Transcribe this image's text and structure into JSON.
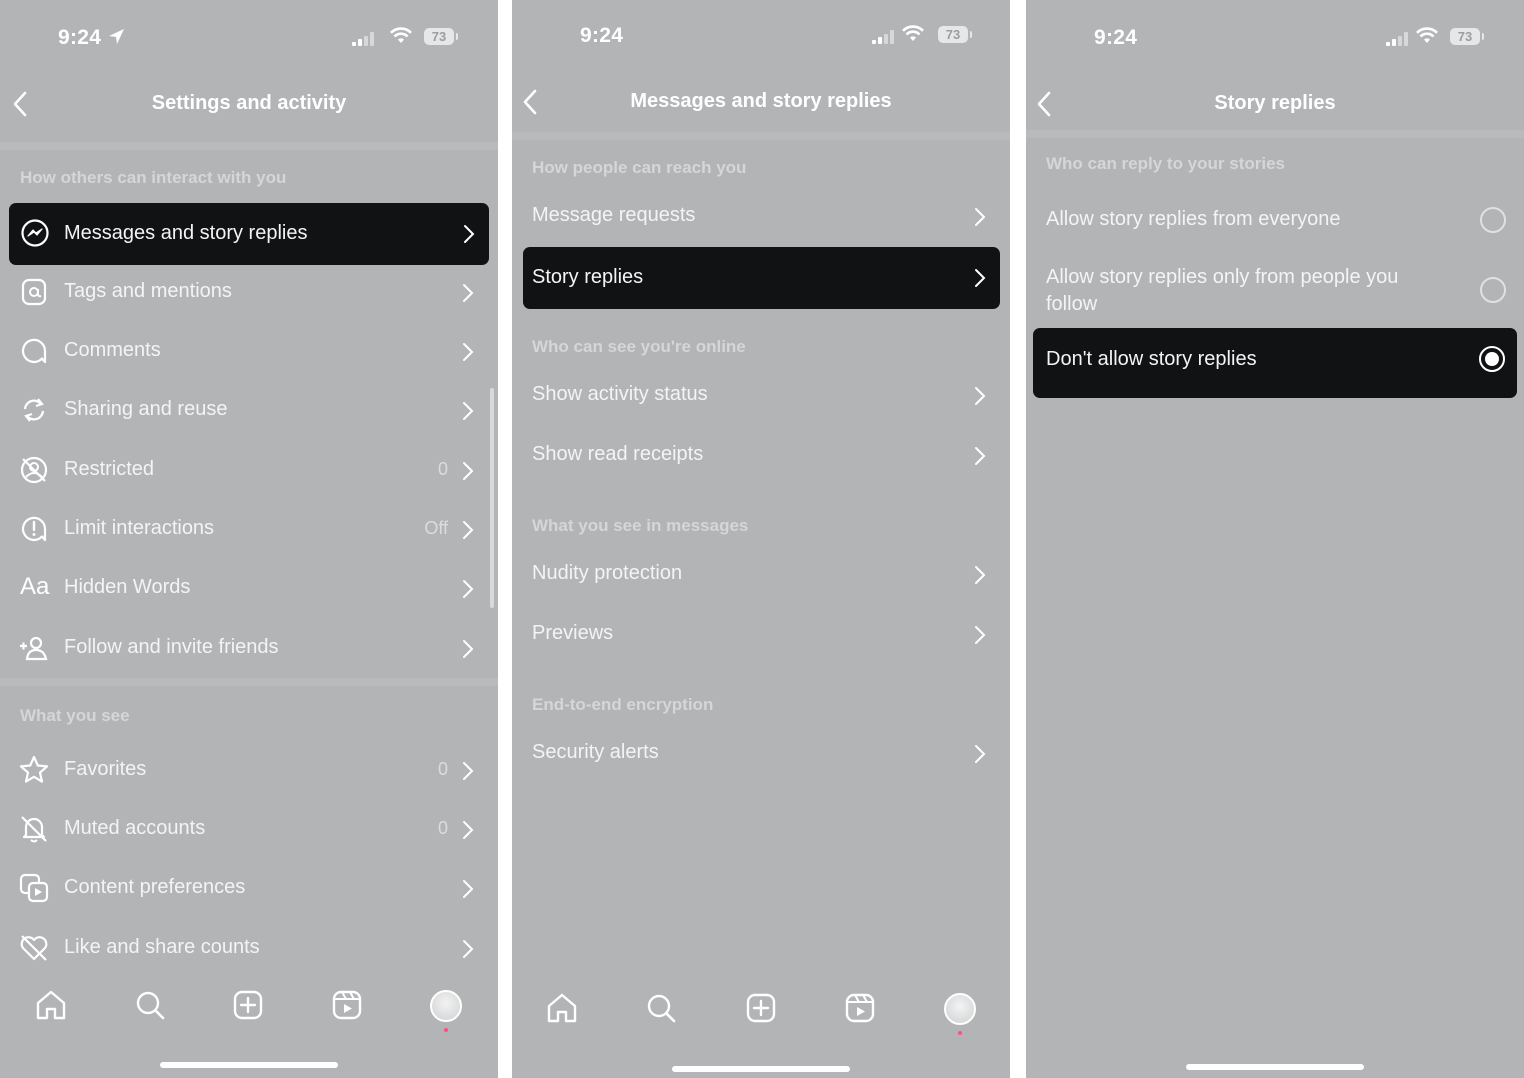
{
  "panel1": {
    "status": {
      "time": "9:24",
      "battery": "73"
    },
    "title": "Settings and activity",
    "section1": "How others can interact with you",
    "items1": [
      {
        "label": "Messages and story replies",
        "value": ""
      },
      {
        "label": "Tags and mentions",
        "value": ""
      },
      {
        "label": "Comments",
        "value": ""
      },
      {
        "label": "Sharing and reuse",
        "value": ""
      },
      {
        "label": "Restricted",
        "value": "0"
      },
      {
        "label": "Limit interactions",
        "value": "Off"
      },
      {
        "label": "Hidden Words",
        "value": ""
      },
      {
        "label": "Follow and invite friends",
        "value": ""
      }
    ],
    "section2": "What you see",
    "items2": [
      {
        "label": "Favorites",
        "value": "0"
      },
      {
        "label": "Muted accounts",
        "value": "0"
      },
      {
        "label": "Content preferences",
        "value": ""
      },
      {
        "label": "Like and share counts",
        "value": ""
      }
    ],
    "hidden_words_icon_text": "Aa"
  },
  "panel2": {
    "status": {
      "time": "9:24",
      "battery": "73"
    },
    "title": "Messages and story replies",
    "section1": "How people can reach you",
    "items1": [
      "Message requests",
      "Story replies"
    ],
    "section2": "Who can see you're online",
    "items2": [
      "Show activity status",
      "Show read receipts"
    ],
    "section3": "What you see in messages",
    "items3": [
      "Nudity protection",
      "Previews"
    ],
    "section4": "End-to-end encryption",
    "items4": [
      "Security alerts"
    ]
  },
  "panel3": {
    "status": {
      "time": "9:24",
      "battery": "73"
    },
    "title": "Story replies",
    "section": "Who can reply to your stories",
    "options": [
      {
        "label": "Allow story replies from everyone",
        "selected": false
      },
      {
        "label": "Allow story replies only from people you follow",
        "selected": false
      },
      {
        "label": "Don't allow story replies",
        "selected": true
      }
    ]
  },
  "colors": {
    "background": "#b3b4b6",
    "highlight": "#111214",
    "text": "#ffffff"
  },
  "tabs": [
    "home-icon",
    "search-icon",
    "create-icon",
    "reels-icon",
    "profile-avatar"
  ]
}
